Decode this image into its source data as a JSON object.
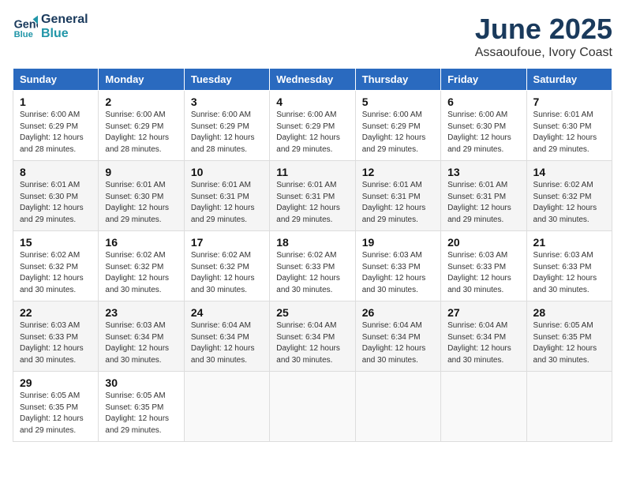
{
  "header": {
    "logo_line1": "General",
    "logo_line2": "Blue",
    "title": "June 2025",
    "subtitle": "Assaoufoue, Ivory Coast"
  },
  "calendar": {
    "days_of_week": [
      "Sunday",
      "Monday",
      "Tuesday",
      "Wednesday",
      "Thursday",
      "Friday",
      "Saturday"
    ],
    "weeks": [
      [
        {
          "day": null
        },
        {
          "day": null
        },
        {
          "day": null
        },
        {
          "day": null
        },
        {
          "day": null
        },
        {
          "day": null
        },
        {
          "day": null
        }
      ],
      [
        {
          "day": 1,
          "sunrise": "6:00 AM",
          "sunset": "6:29 PM",
          "daylight": "12 hours and 28 minutes."
        },
        {
          "day": 2,
          "sunrise": "6:00 AM",
          "sunset": "6:29 PM",
          "daylight": "12 hours and 28 minutes."
        },
        {
          "day": 3,
          "sunrise": "6:00 AM",
          "sunset": "6:29 PM",
          "daylight": "12 hours and 28 minutes."
        },
        {
          "day": 4,
          "sunrise": "6:00 AM",
          "sunset": "6:29 PM",
          "daylight": "12 hours and 29 minutes."
        },
        {
          "day": 5,
          "sunrise": "6:00 AM",
          "sunset": "6:29 PM",
          "daylight": "12 hours and 29 minutes."
        },
        {
          "day": 6,
          "sunrise": "6:00 AM",
          "sunset": "6:30 PM",
          "daylight": "12 hours and 29 minutes."
        },
        {
          "day": 7,
          "sunrise": "6:01 AM",
          "sunset": "6:30 PM",
          "daylight": "12 hours and 29 minutes."
        }
      ],
      [
        {
          "day": 8,
          "sunrise": "6:01 AM",
          "sunset": "6:30 PM",
          "daylight": "12 hours and 29 minutes."
        },
        {
          "day": 9,
          "sunrise": "6:01 AM",
          "sunset": "6:30 PM",
          "daylight": "12 hours and 29 minutes."
        },
        {
          "day": 10,
          "sunrise": "6:01 AM",
          "sunset": "6:31 PM",
          "daylight": "12 hours and 29 minutes."
        },
        {
          "day": 11,
          "sunrise": "6:01 AM",
          "sunset": "6:31 PM",
          "daylight": "12 hours and 29 minutes."
        },
        {
          "day": 12,
          "sunrise": "6:01 AM",
          "sunset": "6:31 PM",
          "daylight": "12 hours and 29 minutes."
        },
        {
          "day": 13,
          "sunrise": "6:01 AM",
          "sunset": "6:31 PM",
          "daylight": "12 hours and 29 minutes."
        },
        {
          "day": 14,
          "sunrise": "6:02 AM",
          "sunset": "6:32 PM",
          "daylight": "12 hours and 30 minutes."
        }
      ],
      [
        {
          "day": 15,
          "sunrise": "6:02 AM",
          "sunset": "6:32 PM",
          "daylight": "12 hours and 30 minutes."
        },
        {
          "day": 16,
          "sunrise": "6:02 AM",
          "sunset": "6:32 PM",
          "daylight": "12 hours and 30 minutes."
        },
        {
          "day": 17,
          "sunrise": "6:02 AM",
          "sunset": "6:32 PM",
          "daylight": "12 hours and 30 minutes."
        },
        {
          "day": 18,
          "sunrise": "6:02 AM",
          "sunset": "6:33 PM",
          "daylight": "12 hours and 30 minutes."
        },
        {
          "day": 19,
          "sunrise": "6:03 AM",
          "sunset": "6:33 PM",
          "daylight": "12 hours and 30 minutes."
        },
        {
          "day": 20,
          "sunrise": "6:03 AM",
          "sunset": "6:33 PM",
          "daylight": "12 hours and 30 minutes."
        },
        {
          "day": 21,
          "sunrise": "6:03 AM",
          "sunset": "6:33 PM",
          "daylight": "12 hours and 30 minutes."
        }
      ],
      [
        {
          "day": 22,
          "sunrise": "6:03 AM",
          "sunset": "6:33 PM",
          "daylight": "12 hours and 30 minutes."
        },
        {
          "day": 23,
          "sunrise": "6:03 AM",
          "sunset": "6:34 PM",
          "daylight": "12 hours and 30 minutes."
        },
        {
          "day": 24,
          "sunrise": "6:04 AM",
          "sunset": "6:34 PM",
          "daylight": "12 hours and 30 minutes."
        },
        {
          "day": 25,
          "sunrise": "6:04 AM",
          "sunset": "6:34 PM",
          "daylight": "12 hours and 30 minutes."
        },
        {
          "day": 26,
          "sunrise": "6:04 AM",
          "sunset": "6:34 PM",
          "daylight": "12 hours and 30 minutes."
        },
        {
          "day": 27,
          "sunrise": "6:04 AM",
          "sunset": "6:34 PM",
          "daylight": "12 hours and 30 minutes."
        },
        {
          "day": 28,
          "sunrise": "6:05 AM",
          "sunset": "6:35 PM",
          "daylight": "12 hours and 30 minutes."
        }
      ],
      [
        {
          "day": 29,
          "sunrise": "6:05 AM",
          "sunset": "6:35 PM",
          "daylight": "12 hours and 29 minutes."
        },
        {
          "day": 30,
          "sunrise": "6:05 AM",
          "sunset": "6:35 PM",
          "daylight": "12 hours and 29 minutes."
        },
        {
          "day": null
        },
        {
          "day": null
        },
        {
          "day": null
        },
        {
          "day": null
        },
        {
          "day": null
        }
      ]
    ]
  }
}
